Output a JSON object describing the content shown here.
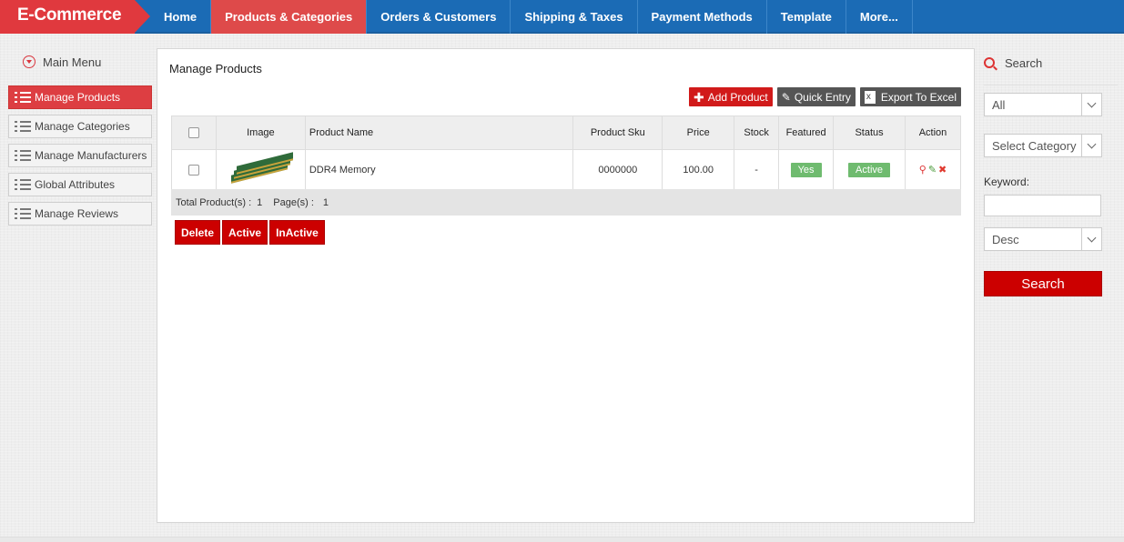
{
  "brand": {
    "text": "E-Commerce"
  },
  "nav": {
    "items": [
      {
        "label": "Home"
      },
      {
        "label": "Products & Categories"
      },
      {
        "label": "Orders & Customers"
      },
      {
        "label": "Shipping & Taxes"
      },
      {
        "label": "Payment Methods"
      },
      {
        "label": "Template"
      },
      {
        "label": "More..."
      }
    ],
    "active_index": 1
  },
  "sidebar": {
    "title": "Main Menu",
    "items": [
      {
        "label": "Manage Products"
      },
      {
        "label": "Manage Categories"
      },
      {
        "label": "Manage Manufacturers"
      },
      {
        "label": "Global Attributes"
      },
      {
        "label": "Manage Reviews"
      }
    ]
  },
  "main": {
    "title": "Manage Products",
    "toolbar": {
      "add_label": "Add Product",
      "quick_label": "Quick Entry",
      "export_label": "Export To Excel"
    },
    "columns": [
      "Image",
      "Product Name",
      "Product Sku",
      "Price",
      "Stock",
      "Featured",
      "Status",
      "Action"
    ],
    "rows": [
      {
        "name": "DDR4 Memory",
        "sku": "0000000",
        "price": "100.00",
        "stock": "-",
        "featured": "Yes",
        "status": "Active"
      }
    ],
    "footer": {
      "total_label": "Total Product(s) :",
      "total_value": "1",
      "pages_label": "Page(s) :",
      "pages_value": "1"
    },
    "bulk": {
      "delete_label": "Delete",
      "active_label": "Active",
      "inactive_label": "InActive"
    }
  },
  "search": {
    "title": "Search",
    "filter_all": "All",
    "category_placeholder": "Select Category",
    "keyword_label": "Keyword:",
    "keyword_value": "",
    "sort_value": "Desc",
    "button_label": "Search"
  },
  "colors": {
    "nav_bg": "#1b6bb5",
    "accent_red": "#dd3e42",
    "button_red": "#cc0000",
    "badge_green": "#6fbb6f"
  }
}
